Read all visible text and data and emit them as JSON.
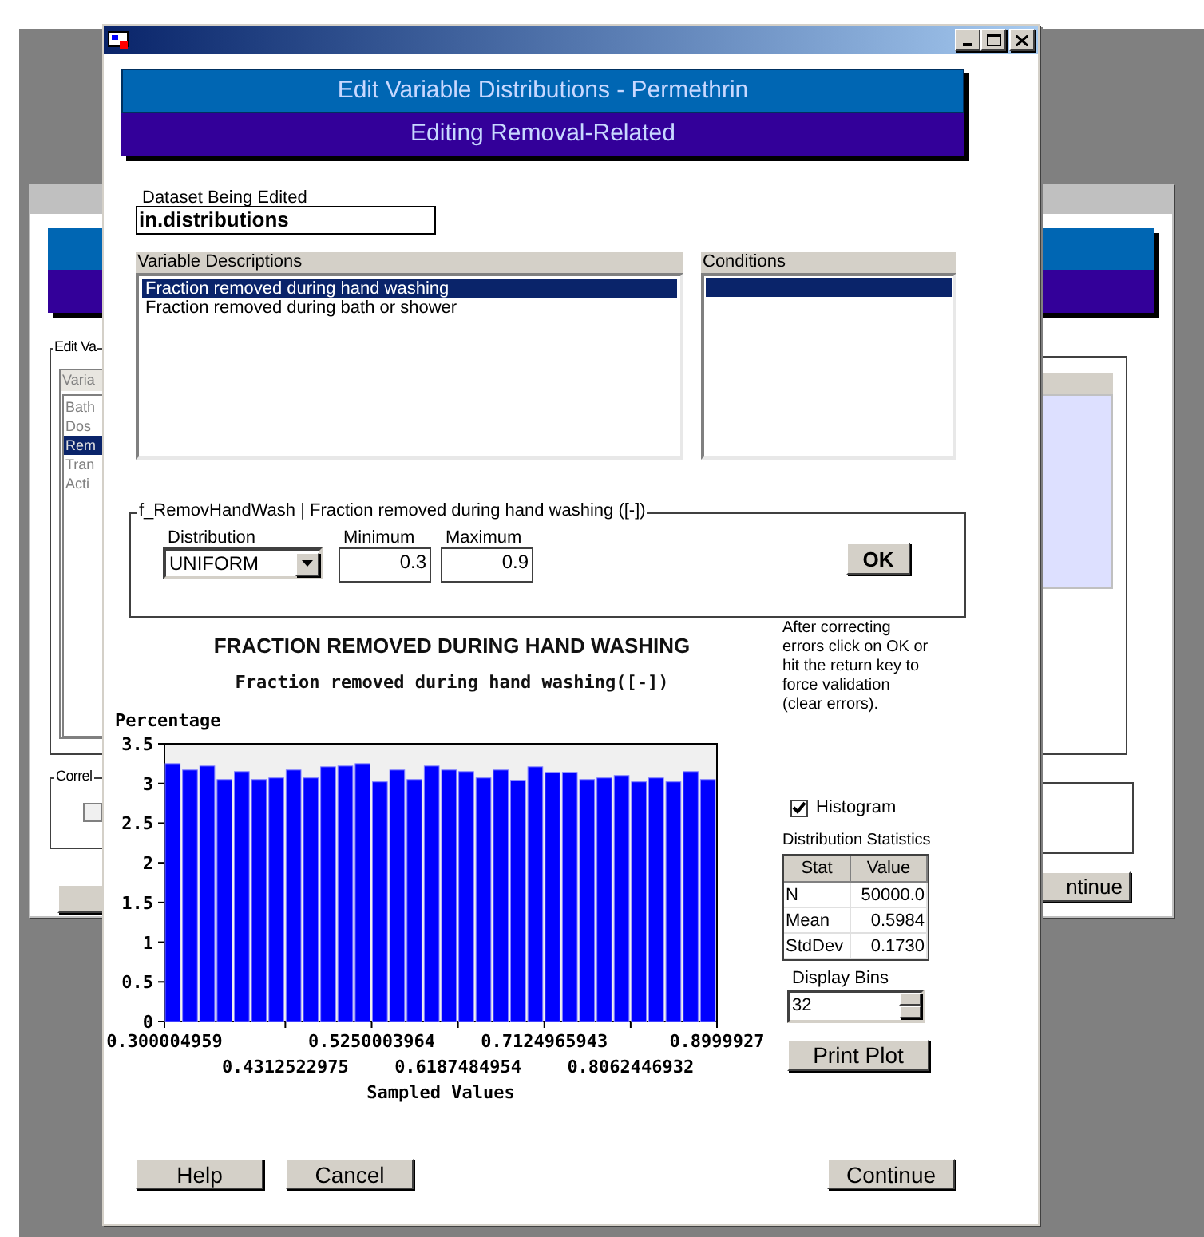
{
  "back_window": {
    "group_label": "Edit Va",
    "list_header": "Varia",
    "list_items": [
      {
        "label": "Bath",
        "selected": false
      },
      {
        "label": "Dos",
        "selected": false
      },
      {
        "label": "Rem",
        "selected": true
      },
      {
        "label": "Tran",
        "selected": false
      },
      {
        "label": "Acti",
        "selected": false
      }
    ],
    "group2_label": "Correl",
    "checkbox_checked": false,
    "button_label": "ntinue"
  },
  "window": {
    "banner_title": "Edit Variable Distributions - Permethrin",
    "banner_subtitle": "Editing Removal-Related"
  },
  "dataset": {
    "label": "Dataset Being Edited",
    "value": "in.distributions"
  },
  "variables": {
    "header": "Variable Descriptions",
    "items": [
      {
        "label": "Fraction removed during hand washing",
        "selected": true
      },
      {
        "label": "Fraction removed during bath or shower",
        "selected": false
      }
    ]
  },
  "conditions": {
    "header": "Conditions",
    "row_selected": true
  },
  "parameters": {
    "title": "f_RemovHandWash | Fraction removed during hand washing ([-])",
    "distribution": {
      "label": "Distribution",
      "value": "UNIFORM"
    },
    "fields": [
      {
        "label": "Minimum",
        "value": "0.3"
      },
      {
        "label": "Maximum",
        "value": "0.9"
      }
    ],
    "ok_button": "OK"
  },
  "hint": "After correcting errors click on OK or hit the return key to force validation (clear errors).",
  "chart": {
    "subtitle": "Fraction removed during hand washing([-])",
    "lower_tick_labels": [
      "0.4312522975",
      "0.6187484954",
      "0.8062446932"
    ],
    "chart_data": {
      "type": "bar",
      "title": "FRACTION REMOVED DURING HAND WASHING",
      "xlabel": "Sampled Values",
      "ylabel": "Percentage",
      "x": [
        0.309375,
        0.328125,
        0.346875,
        0.365625,
        0.384375,
        0.403125,
        0.421875,
        0.440625,
        0.459375,
        0.478125,
        0.496875,
        0.515625,
        0.534375,
        0.553125,
        0.571875,
        0.590625,
        0.609375,
        0.628125,
        0.646875,
        0.665625,
        0.684375,
        0.703125,
        0.721875,
        0.740625,
        0.759375,
        0.778125,
        0.796875,
        0.815625,
        0.834375,
        0.853125,
        0.871875,
        0.890625
      ],
      "series": [
        {
          "color": "#0000ff",
          "values": [
            3.25,
            3.17,
            3.22,
            3.05,
            3.15,
            3.05,
            3.07,
            3.17,
            3.07,
            3.21,
            3.22,
            3.25,
            3.02,
            3.17,
            3.05,
            3.22,
            3.17,
            3.15,
            3.07,
            3.17,
            3.04,
            3.21,
            3.14,
            3.14,
            3.05,
            3.07,
            3.1,
            3.02,
            3.07,
            3.02,
            3.15,
            3.05
          ]
        }
      ],
      "xlim": [
        0.300004959,
        0.8999927
      ],
      "ylim": [
        0,
        3.5
      ],
      "xticks": [
        0.300004959,
        0.5250003964,
        0.7124965943,
        0.8999927
      ],
      "yticks": [
        0,
        0.5,
        1,
        1.5,
        2,
        2.5,
        3,
        3.5
      ]
    }
  },
  "histogram": {
    "label": "Histogram",
    "checked": true
  },
  "statistics": {
    "title": "Distribution Statistics",
    "columns": [
      "Stat",
      "Value"
    ],
    "rows": [
      [
        "N",
        "50000.0"
      ],
      [
        "Mean",
        "0.5984"
      ],
      [
        "StdDev",
        "0.1730"
      ]
    ]
  },
  "display_bins": {
    "label": "Display Bins",
    "value": "32"
  },
  "print_button": "Print Plot",
  "footer_buttons": [
    "Help",
    "Cancel",
    "Continue"
  ]
}
